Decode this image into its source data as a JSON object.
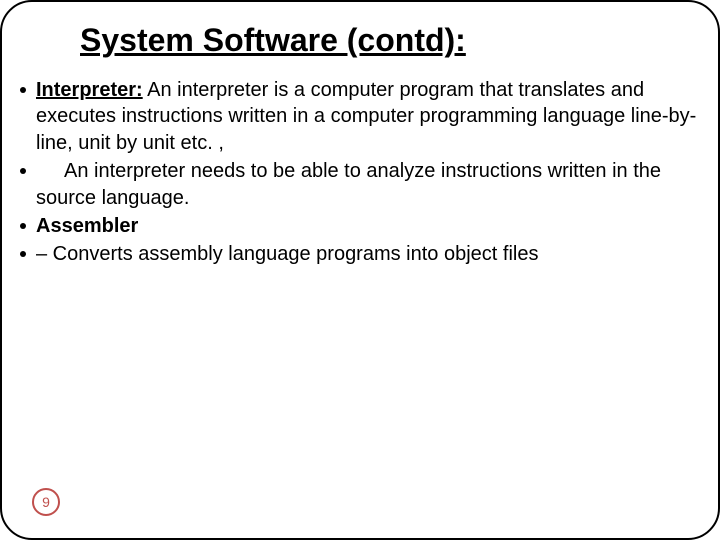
{
  "title": "System Software (contd):",
  "bullets": {
    "b1": {
      "strong": "Interpreter:",
      "rest": " An interpreter is a computer program that translates and executes instructions written in a computer programming language line-by-line, unit by unit etc. ,"
    },
    "b2": {
      "text": "An interpreter needs to be able to analyze instructions written in the source language."
    },
    "b3": {
      "strong": "Assembler"
    },
    "b4": {
      "text": "– Converts assembly language programs into object files"
    }
  },
  "page_number": "9"
}
